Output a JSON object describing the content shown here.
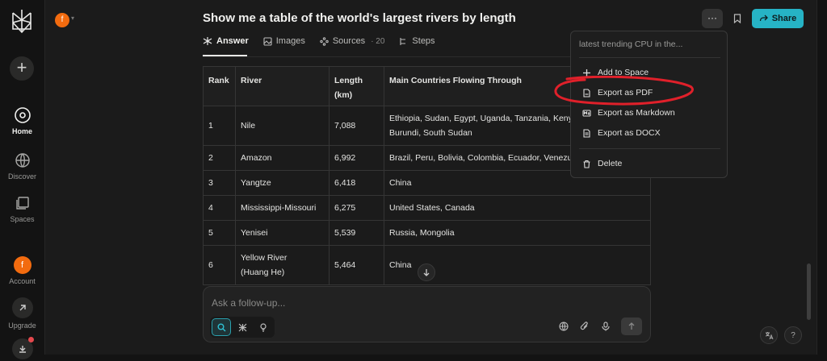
{
  "sidebar": {
    "logo": "perplexity-logo-icon",
    "new_thread": "+",
    "items": [
      {
        "label": "Home",
        "icon": "home-search-icon"
      },
      {
        "label": "Discover",
        "icon": "globe-icon"
      },
      {
        "label": "Spaces",
        "icon": "spaces-icon"
      }
    ],
    "account": {
      "label": "Account",
      "avatar": "f"
    },
    "upgrade": {
      "label": "Upgrade",
      "icon": "upgrade-arrow-icon"
    },
    "download_icon": "download-icon"
  },
  "header": {
    "avatar": "f",
    "title": "Show me a table of the world's largest rivers by length",
    "share_label": "Share",
    "more_label": "···"
  },
  "tabs": [
    {
      "label": "Answer",
      "icon": "answer-icon",
      "active": true
    },
    {
      "label": "Images",
      "icon": "image-icon"
    },
    {
      "label": "Sources",
      "icon": "sources-icon",
      "count": "· 20"
    },
    {
      "label": "Steps",
      "icon": "steps-icon"
    }
  ],
  "table": {
    "headers": [
      "Rank",
      "River",
      "Length (km)",
      "Main Countries Flowing Through"
    ],
    "rows": [
      [
        "1",
        "Nile",
        "7,088",
        "Ethiopia, Sudan, Egypt, Uganda, Tanzania, Kenya,",
        "Burundi, South Sudan"
      ],
      [
        "2",
        "Amazon",
        "6,992",
        "Brazil, Peru, Bolivia, Colombia, Ecuador, Venezuela"
      ],
      [
        "3",
        "Yangtze",
        "6,418",
        "China"
      ],
      [
        "4",
        "Mississippi-Missouri",
        "6,275",
        "United States, Canada"
      ],
      [
        "5",
        "Yenisei",
        "5,539",
        "Russia, Mongolia"
      ],
      [
        "6",
        "Yellow River",
        "5,464",
        "China",
        "(Huang He)"
      ]
    ]
  },
  "followup": {
    "placeholder": "Ask a follow-up..."
  },
  "dropdown": {
    "header": "latest trending CPU in the...",
    "items": [
      {
        "label": "Add to Space",
        "icon": "plus-icon"
      },
      {
        "label": "Export as PDF",
        "icon": "pdf-file-icon"
      },
      {
        "label": "Export as Markdown",
        "icon": "markdown-icon"
      },
      {
        "label": "Export as DOCX",
        "icon": "docx-file-icon"
      },
      {
        "label": "Delete",
        "icon": "trash-icon"
      }
    ]
  },
  "colors": {
    "accent": "#26b3c5",
    "avatar": "#f26b0f",
    "annotation": "#e0202a",
    "background": "#1b1b1b"
  }
}
